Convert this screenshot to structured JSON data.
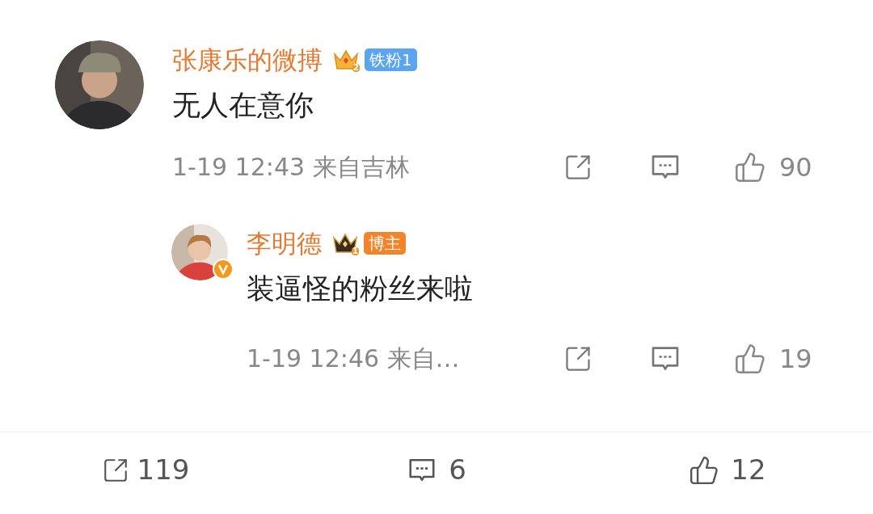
{
  "comments": [
    {
      "author": "张康乐的微搏",
      "crown_level": "2",
      "badge": {
        "kind": "fan",
        "label": "铁粉1"
      },
      "verified": false,
      "kind": "comment",
      "text": "无人在意你",
      "time": "1-19 12:43 来自吉林",
      "likes": "90"
    },
    {
      "author": "李明德",
      "crown_level": "1",
      "badge": {
        "kind": "blogger",
        "label": "博主"
      },
      "verified": true,
      "kind": "reply",
      "text": "装逼怪的粉丝来啦",
      "time": "1-19 12:46 来自…",
      "likes": "19"
    }
  ],
  "footer": {
    "shares": "119",
    "comments": "6",
    "likes": "12"
  }
}
